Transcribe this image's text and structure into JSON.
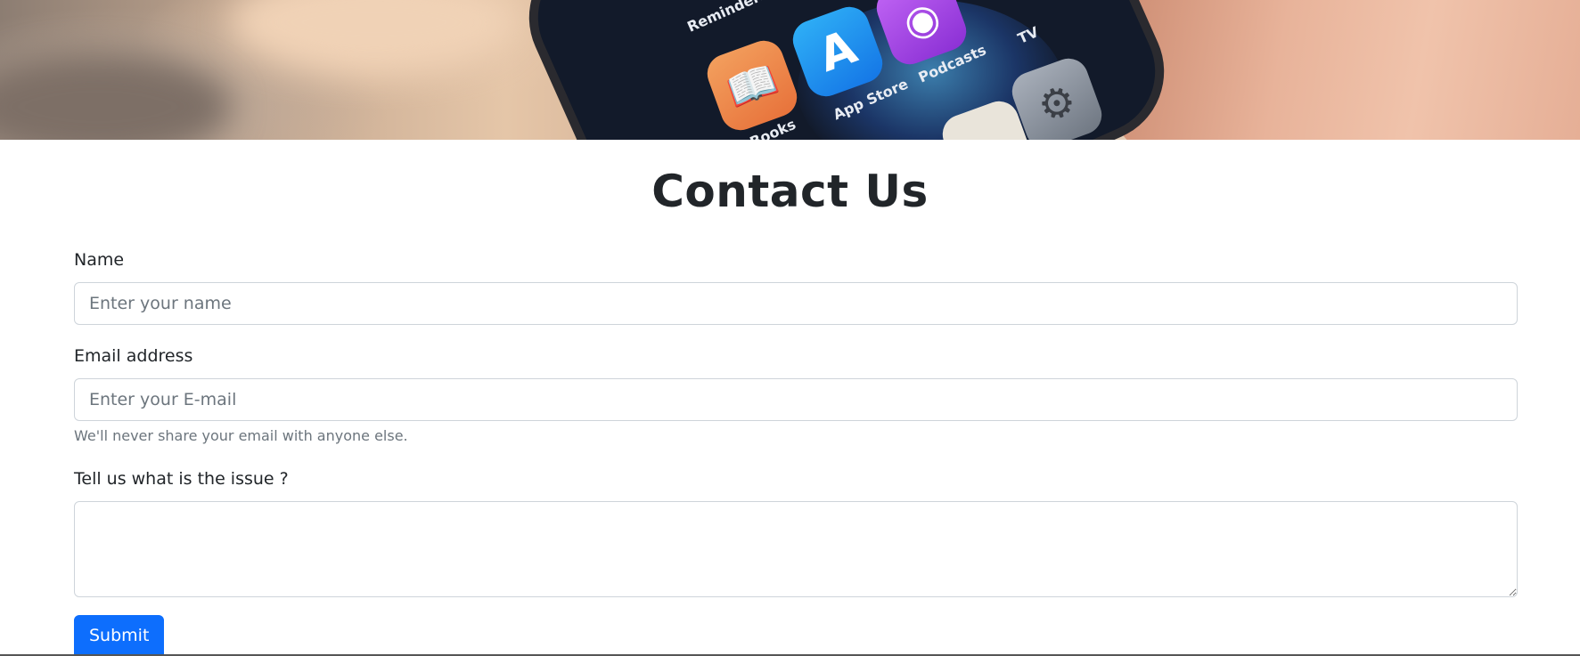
{
  "hero": {
    "app_labels": {
      "reminders": "Reminders",
      "app_store": "App Store",
      "podcasts": "Podcasts",
      "tv": "TV",
      "books": "Books"
    }
  },
  "page": {
    "title": "Contact Us"
  },
  "form": {
    "name_label": "Name",
    "name_placeholder": "Enter your name",
    "email_label": "Email address",
    "email_placeholder": "Enter your E-mail",
    "email_help": "We'll never share your email with anyone else.",
    "issue_label": "Tell us what is the issue ?",
    "issue_value": "",
    "submit_label": "Submit"
  },
  "colors": {
    "primary": "#0d6efd",
    "text": "#212529",
    "muted": "#6c757d",
    "border": "#ced4da"
  }
}
